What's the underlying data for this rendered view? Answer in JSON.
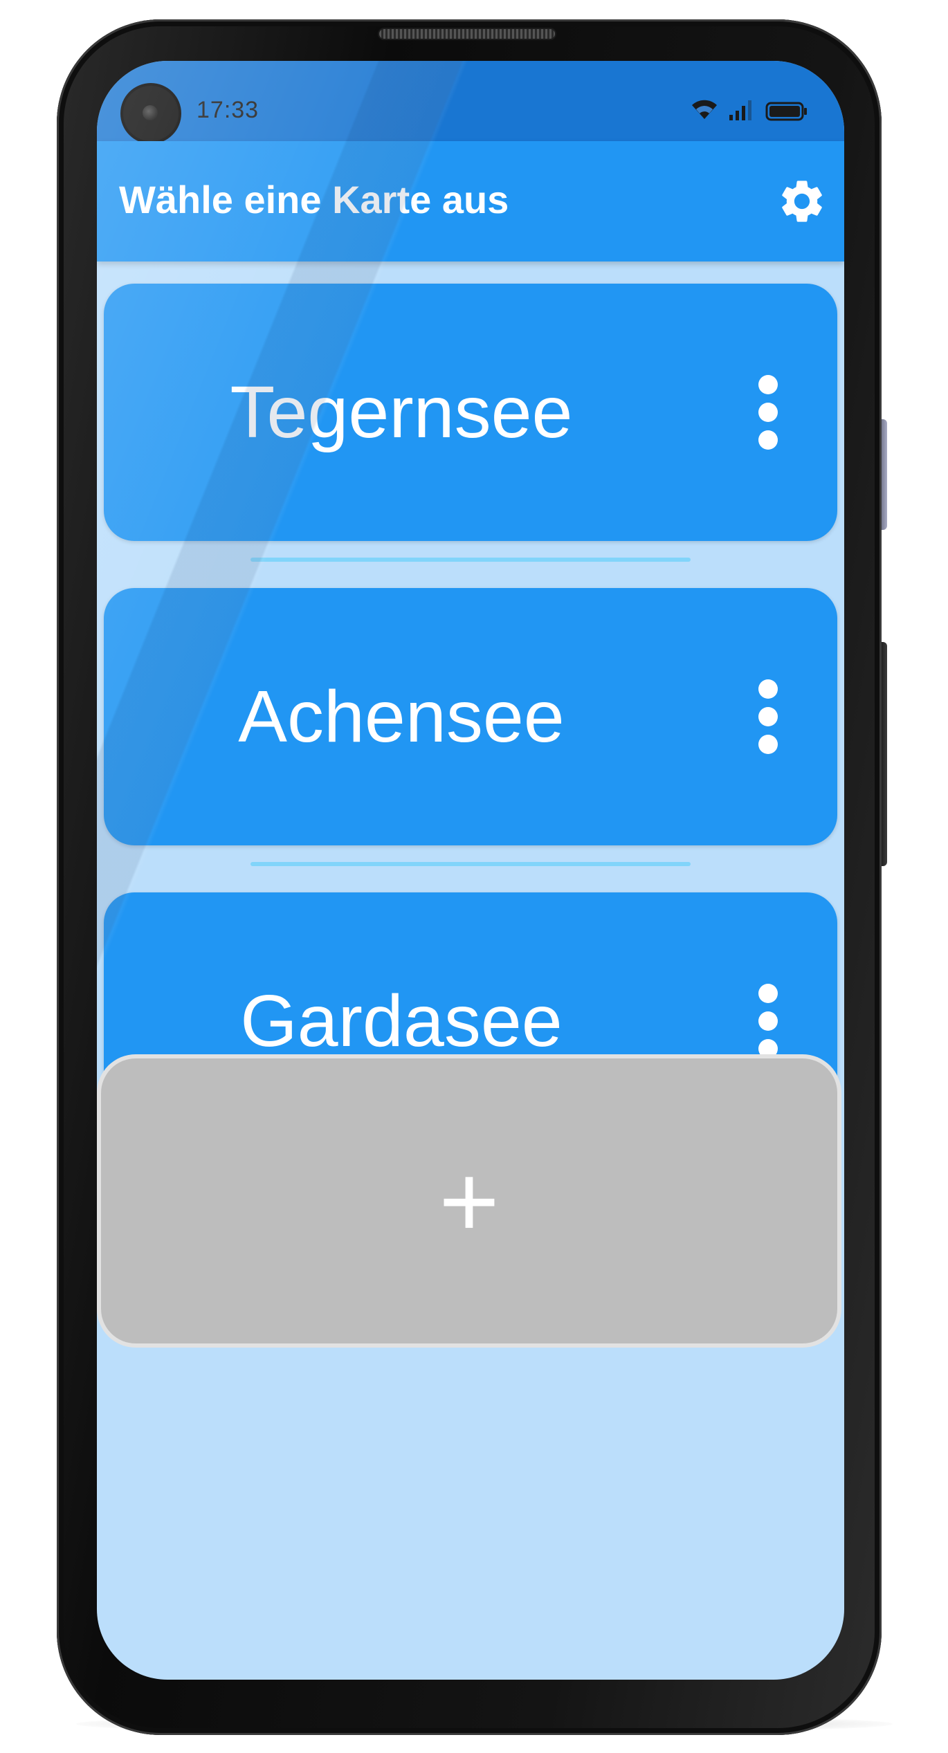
{
  "status_bar": {
    "time": "17:33",
    "icons": [
      "wifi-icon",
      "signal-icon",
      "battery-icon"
    ]
  },
  "app_bar": {
    "title": "Wähle eine Karte aus",
    "settings_icon": "gear-icon",
    "color": "#2196f3"
  },
  "maps": {
    "items": [
      {
        "label": "Tegernsee",
        "menu_icon": "more-vert-icon"
      },
      {
        "label": "Achensee",
        "menu_icon": "more-vert-icon"
      },
      {
        "label": "Gardasee",
        "menu_icon": "more-vert-icon"
      }
    ],
    "add_label": "+",
    "card_color": "#2196f3",
    "add_card_color": "#bdbdbd",
    "background_color": "#bbdefb",
    "divider_color": "#81d4fa"
  }
}
